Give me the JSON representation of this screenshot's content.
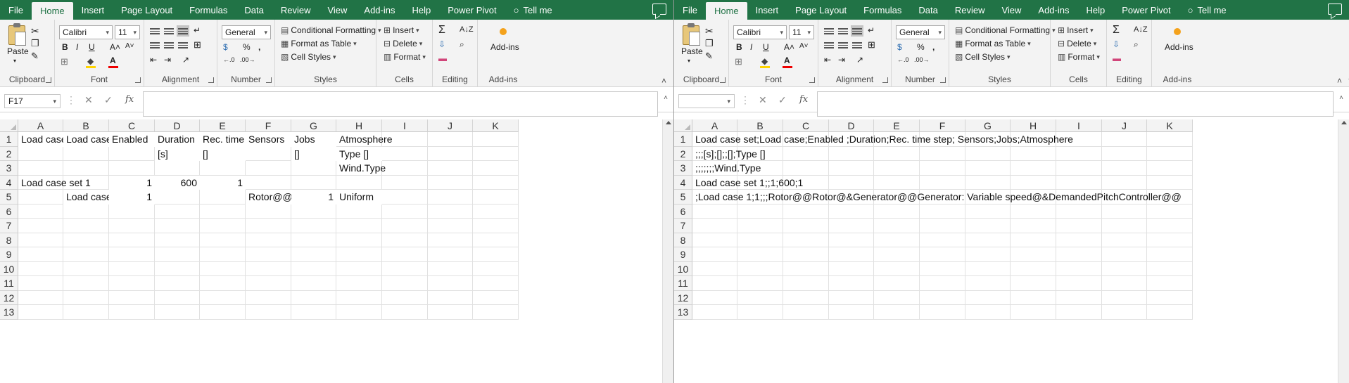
{
  "tabs": [
    "File",
    "Home",
    "Insert",
    "Page Layout",
    "Formulas",
    "Data",
    "Review",
    "View",
    "Add-ins",
    "Help",
    "Power Pivot",
    "Tell me"
  ],
  "ribbon": {
    "clipboard": {
      "paste_label": "Paste",
      "group": "Clipboard"
    },
    "font": {
      "name": "Calibri",
      "size": "11",
      "group": "Font",
      "bold": "B",
      "italic": "I",
      "underline": "U"
    },
    "alignment": {
      "group": "Alignment"
    },
    "number": {
      "format": "General",
      "group": "Number",
      "percent": "%"
    },
    "styles": {
      "conditional": "Conditional Formatting",
      "format_table": "Format as Table",
      "cell_styles": "Cell Styles",
      "group": "Styles"
    },
    "cells": {
      "insert": "Insert",
      "delete": "Delete",
      "format": "Format",
      "group": "Cells"
    },
    "editing": {
      "group": "Editing"
    },
    "addins": {
      "label": "Add-ins",
      "group": "Add-ins"
    }
  },
  "columns": [
    "A",
    "B",
    "C",
    "D",
    "E",
    "F",
    "G",
    "H",
    "I",
    "J",
    "K"
  ],
  "rows": [
    "1",
    "2",
    "3",
    "4",
    "5",
    "6",
    "7",
    "8",
    "9",
    "10",
    "11",
    "12",
    "13"
  ],
  "left": {
    "namebox": "F17",
    "cells": {
      "A1": "Load case",
      "B1": "Load case",
      "C1": "Enabled",
      "D1": "Duration",
      "E1": "Rec. time :",
      "F1": "Sensors",
      "G1": "Jobs",
      "H1": "Atmosphere",
      "D2": "[s]",
      "E2": "[]",
      "G2": "[]",
      "H2": "Type []",
      "H3": "Wind.Type",
      "A4": "Load case set 1",
      "C4": "1",
      "D4": "600",
      "E4": "1",
      "B5": "Load case",
      "C5": "1",
      "F5": "Rotor@@",
      "G5": "1",
      "H5": "Uniform"
    }
  },
  "right": {
    "namebox": "",
    "lines": {
      "A1": "Load case set;Load case;Enabled ;Duration;Rec. time step; Sensors;Jobs;Atmosphere",
      "A2": ";;;[s];[];;[];Type []",
      "A3": ";;;;;;;Wind.Type",
      "A4": "Load case set 1;;1;600;1",
      "A5": ";Load case 1;1;;;Rotor@@Rotor@&Generator@@Generator: Variable speed@&DemandedPitchController@@Demanded p"
    }
  }
}
